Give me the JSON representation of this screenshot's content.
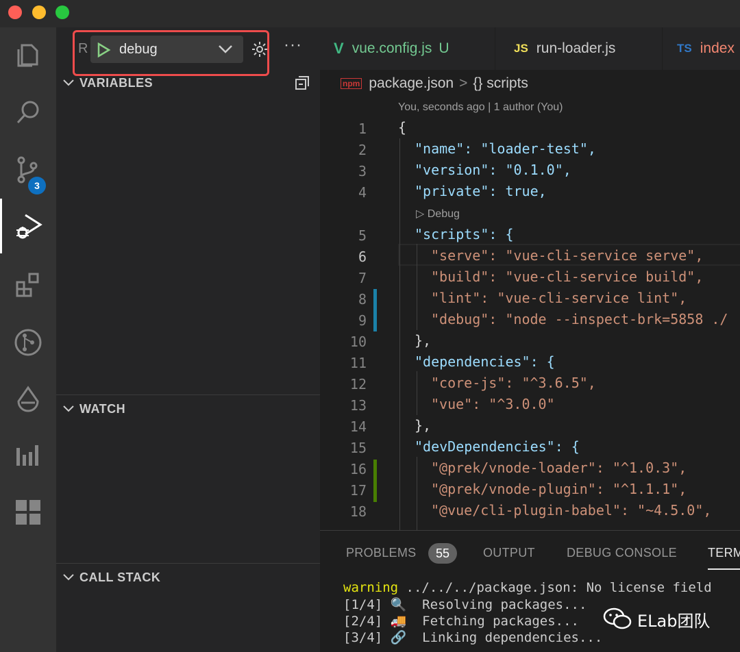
{
  "sidebar": {
    "run_letter": "R",
    "config_name": "debug",
    "more": "···",
    "sections": {
      "variables": "VARIABLES",
      "watch": "WATCH",
      "call_stack": "CALL STACK"
    }
  },
  "activity": {
    "scm_badge": "3"
  },
  "tabs": [
    {
      "icon": "V",
      "label": "vue.config.js",
      "status": "U"
    },
    {
      "icon": "JS",
      "label": "run-loader.js"
    },
    {
      "icon": "TS",
      "label": "index"
    }
  ],
  "breadcrumb": {
    "icon": "npm",
    "file": "package.json",
    "sep": ">",
    "symbol": "{} scripts"
  },
  "editor": {
    "blame": "You, seconds ago | 1 author (You)",
    "codelens": "Debug",
    "lines": [
      {
        "n": "1",
        "text": "{"
      },
      {
        "n": "2",
        "text": "\"name\": \"loader-test\","
      },
      {
        "n": "3",
        "text": "\"version\": \"0.1.0\","
      },
      {
        "n": "4",
        "text": "\"private\": true,"
      },
      {
        "n": "5",
        "text": "\"scripts\": {"
      },
      {
        "n": "6",
        "text": "\"serve\": \"vue-cli-service serve\","
      },
      {
        "n": "7",
        "text": "\"build\": \"vue-cli-service build\","
      },
      {
        "n": "8",
        "text": "\"lint\": \"vue-cli-service lint\","
      },
      {
        "n": "9",
        "text": "\"debug\": \"node --inspect-brk=5858 ./"
      },
      {
        "n": "10",
        "text": "},"
      },
      {
        "n": "11",
        "text": "\"dependencies\": {"
      },
      {
        "n": "12",
        "text": "\"core-js\": \"^3.6.5\","
      },
      {
        "n": "13",
        "text": "\"vue\": \"^3.0.0\""
      },
      {
        "n": "14",
        "text": "},"
      },
      {
        "n": "15",
        "text": "\"devDependencies\": {"
      },
      {
        "n": "16",
        "text": "\"@prek/vnode-loader\": \"^1.0.3\","
      },
      {
        "n": "17",
        "text": "\"@prek/vnode-plugin\": \"^1.1.1\","
      },
      {
        "n": "18",
        "text": "\"@vue/cli-plugin-babel\": \"~4.5.0\","
      }
    ]
  },
  "panel": {
    "tabs": [
      "PROBLEMS",
      "OUTPUT",
      "DEBUG CONSOLE",
      "TERMINAL"
    ],
    "problems_count": "55",
    "terminal": [
      {
        "prefix": "warning",
        "text": " ../../../package.json: No license field"
      },
      {
        "prefix": "",
        "text": "[1/4] 🔍  Resolving packages..."
      },
      {
        "prefix": "",
        "text": "[2/4] 🚚  Fetching packages..."
      },
      {
        "prefix": "",
        "text": "[3/4] 🔗  Linking dependencies..."
      }
    ]
  },
  "watermark": "ELab团队",
  "colors": {
    "accent": "#0e70c0",
    "highlight_box": "#ee4c4c",
    "play": "#89d185",
    "vue_green": "#41b883",
    "js_yellow": "#f1e05a",
    "ts_blue": "#3178c6"
  }
}
